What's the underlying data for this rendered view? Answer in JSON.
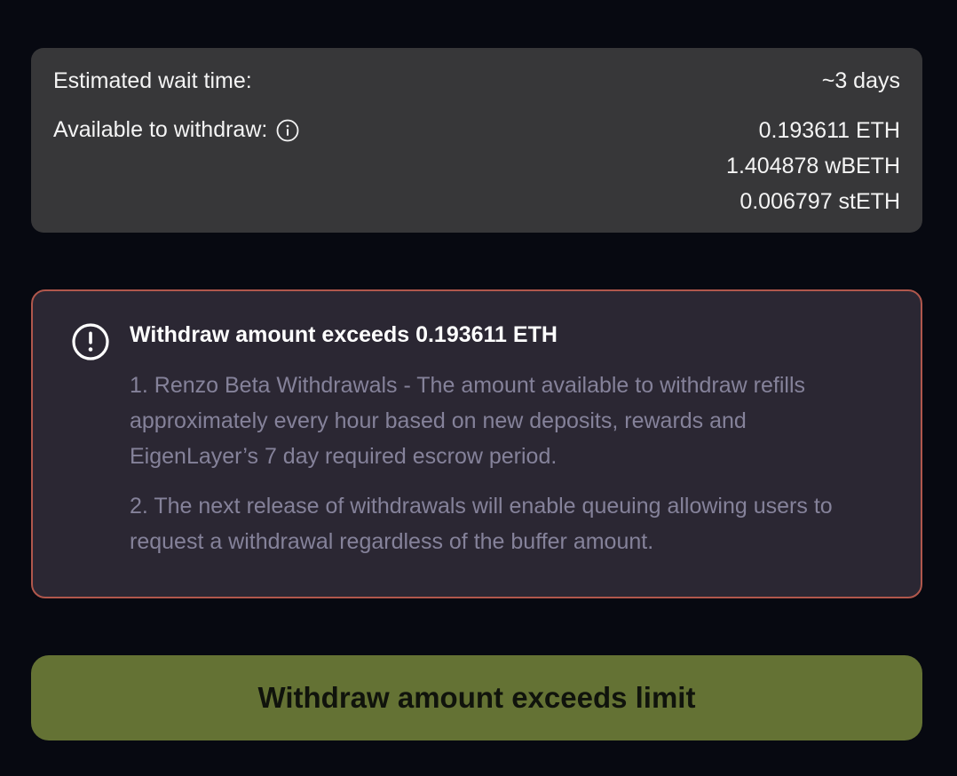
{
  "info_card": {
    "wait_label": "Estimated wait time:",
    "wait_value": "~3 days",
    "available_label": "Available to withdraw:",
    "available_icon": "info-icon",
    "amounts": [
      "0.193611 ETH",
      "1.404878 wBETH",
      "0.006797 stETH"
    ]
  },
  "warning": {
    "icon": "alert-circle-icon",
    "title": "Withdraw amount exceeds 0.193611 ETH",
    "paragraphs": [
      "1. Renzo Beta Withdrawals - The amount available to withdraw refills approximately every hour based on new deposits, rewards and EigenLayer’s 7 day required escrow period.",
      "2. The next release of withdrawals will enable queuing allowing users to request a withdrawal regardless of the buffer amount."
    ],
    "border_color": "#b0574c",
    "background_color": "#2b2733"
  },
  "action_button": {
    "label": "Withdraw amount exceeds limit",
    "background_color": "#647234"
  }
}
